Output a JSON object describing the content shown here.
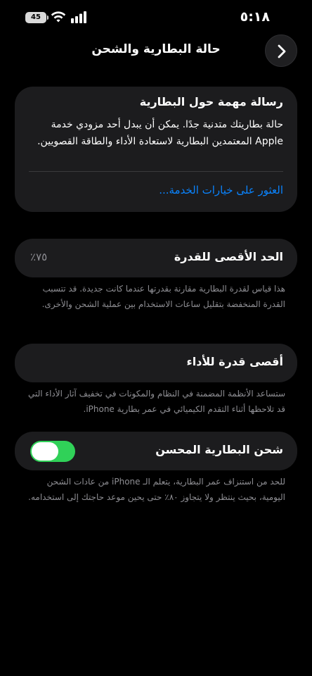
{
  "status_bar": {
    "time": "٥:١٨",
    "battery_level": "45",
    "icons": [
      "battery-icon",
      "wifi-icon",
      "cellular-signal-icon"
    ]
  },
  "nav": {
    "title": "حالة البطارية والشحن",
    "back_icon": "chevron-right-icon"
  },
  "message_card": {
    "title": "رسالة مهمة حول البطارية",
    "body": "حالة بطاريتك متدنية جدًا. يمكن أن يبدل أحد مزودي خدمة Apple المعتمدين البطارية لاستعادة الأداء والطاقة القصويين.",
    "link": "العثور على خيارات الخدمة..."
  },
  "max_capacity": {
    "label": "الحد الأقصى للقدرة",
    "value": "٧٥٪",
    "footnote": "هذا قياس لقدرة البطارية مقارنة بقدرتها عندما كانت جديدة. قد تتسبب القدرة المنخفضة بتقليل ساعات الاستخدام بين عملية الشحن والأخرى."
  },
  "peak_performance": {
    "label": "أقصى قدرة للأداء",
    "footnote": "ستساعد الأنظمة المضمنة في النظام والمكونات في تخفيف آثار الأداء التي قد تلاحظها أثناء التقدم الكيميائي في عمر بطارية iPhone."
  },
  "optimized_charging": {
    "label": "شحن البطارية المحسن",
    "enabled": true,
    "footnote": "للحد من استنزاف عمر البطارية، يتعلم الـ iPhone من عادات الشحن اليومية، بحيث ينتظر ولا يتجاوز ٨٠٪ حتى يحين موعد حاجتك إلى استخدامه."
  },
  "colors": {
    "background": "#000000",
    "card": "#1c1c1e",
    "link": "#0a84ff",
    "toggle_on": "#30d158",
    "secondary_text": "#8e8e93"
  }
}
